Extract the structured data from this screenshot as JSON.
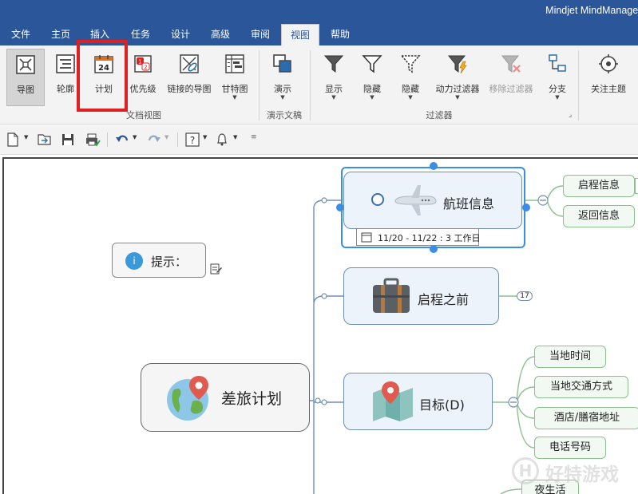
{
  "window": {
    "title": "Mindjet MindManager - "
  },
  "tabs": [
    {
      "label": "文件"
    },
    {
      "label": "主页"
    },
    {
      "label": "插入"
    },
    {
      "label": "任务"
    },
    {
      "label": "设计"
    },
    {
      "label": "高级"
    },
    {
      "label": "审阅"
    },
    {
      "label": "视图"
    },
    {
      "label": "帮助"
    }
  ],
  "ribbon": {
    "doc_views": {
      "group_label": "文档视图",
      "map": "导图",
      "outline": "轮廓",
      "schedule": "计划",
      "priority": "优先级",
      "linked_maps": "链接的导图",
      "gantt": "甘特图"
    },
    "presentation": {
      "group_label": "演示文稿",
      "present": "演示"
    },
    "filter": {
      "group_label": "过滤器",
      "show": "显示",
      "hide": "隐藏",
      "hide2": "隐藏",
      "power_filter": "动力过滤器",
      "remove_filter": "移除过滤器",
      "branch": "分支"
    },
    "focus": {
      "label": "关注主题"
    },
    "calendar_day": "24"
  },
  "map": {
    "central": {
      "label": "差旅计划"
    },
    "callout": {
      "label": "提示：",
      "icon_text": "i"
    },
    "flight": {
      "label": "航班信息",
      "date_range": "11/20 - 11/22 : 3 工作日",
      "children": [
        "启程信息",
        "返回信息"
      ]
    },
    "before": {
      "label": "启程之前",
      "count": "17"
    },
    "destination": {
      "label": "目标(D)",
      "children": [
        "当地时间",
        "当地交通方式",
        "酒店/膳宿地址",
        "电话号码"
      ]
    },
    "nightlife": {
      "label": "夜生活"
    }
  },
  "watermark": {
    "text": "好特游戏"
  },
  "colors": {
    "brand": "#2b579a",
    "highlight_box": "#e02020",
    "topic_border": "#6f8fb5",
    "subtopic_border": "#8cc08e"
  }
}
